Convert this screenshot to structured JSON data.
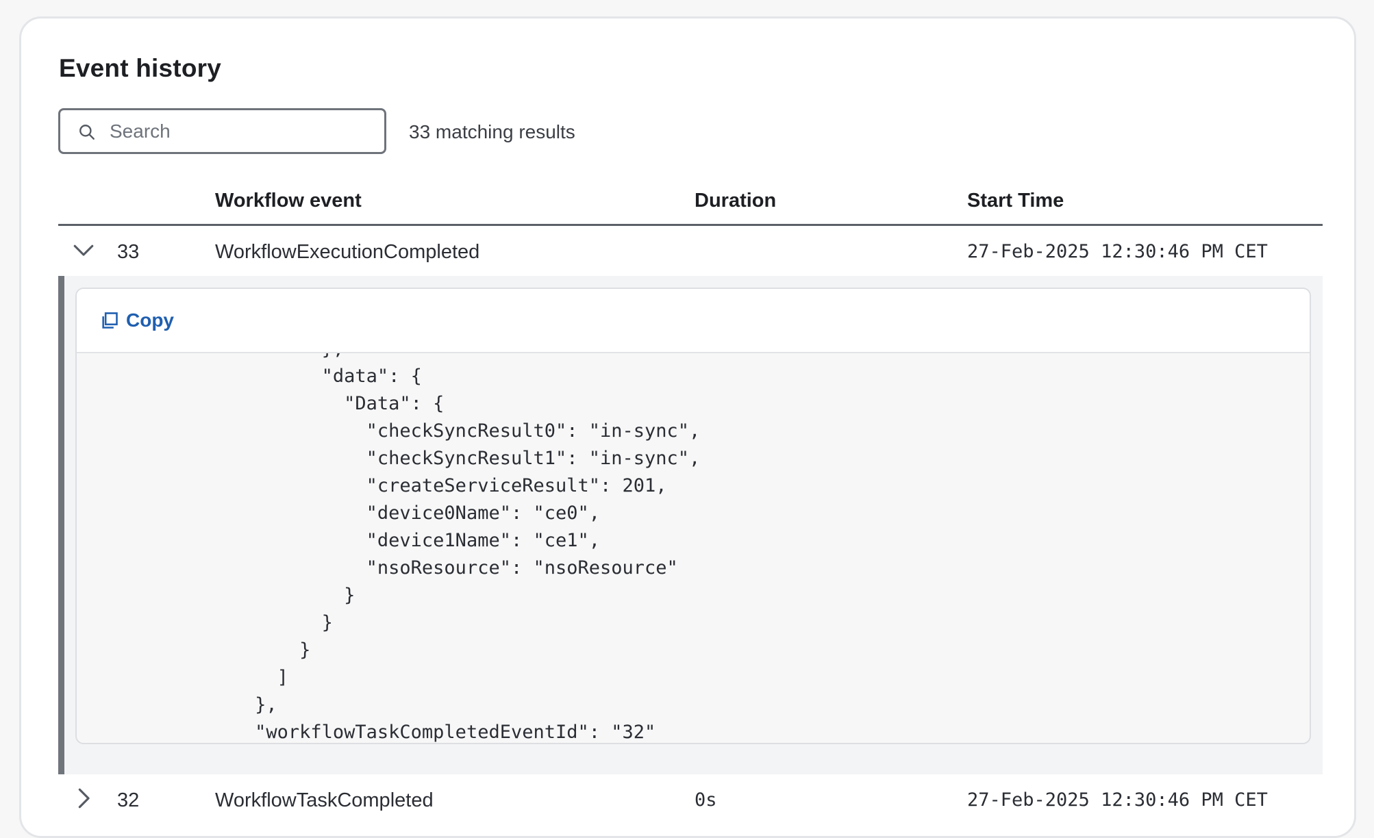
{
  "header": {
    "title": "Event history"
  },
  "search": {
    "placeholder": "Search",
    "value": "",
    "results_text": "33 matching results"
  },
  "table": {
    "columns": {
      "event": "Workflow event",
      "duration": "Duration",
      "start": "Start Time"
    },
    "rows": [
      {
        "id": "33",
        "event": "WorkflowExecutionCompleted",
        "duration": "",
        "start": "27-Feb-2025 12:30:46 PM CET",
        "expanded": true
      },
      {
        "id": "32",
        "event": "WorkflowTaskCompleted",
        "duration": "0s",
        "start": "27-Feb-2025 12:30:46 PM CET",
        "expanded": false
      }
    ]
  },
  "detail": {
    "copy_label": "Copy",
    "code_lines": [
      "      },",
      "      \"data\": {",
      "        \"Data\": {",
      "          \"checkSyncResult0\": \"in-sync\",",
      "          \"checkSyncResult1\": \"in-sync\",",
      "          \"createServiceResult\": 201,",
      "          \"device0Name\": \"ce0\",",
      "          \"device1Name\": \"ce1\",",
      "          \"nsoResource\": \"nsoResource\"",
      "        }",
      "      }",
      "    }",
      "  ]",
      "},",
      "\"workflowTaskCompletedEventId\": \"32\""
    ]
  },
  "icons": {
    "search": "search-icon",
    "expanded_chevron": "chevron-down-icon",
    "collapsed_chevron": "chevron-right-icon",
    "copy": "copy-icon"
  },
  "colors": {
    "accent": "#1f5fb0",
    "panel_border": "#70757c",
    "header_line": "#5b6068"
  }
}
